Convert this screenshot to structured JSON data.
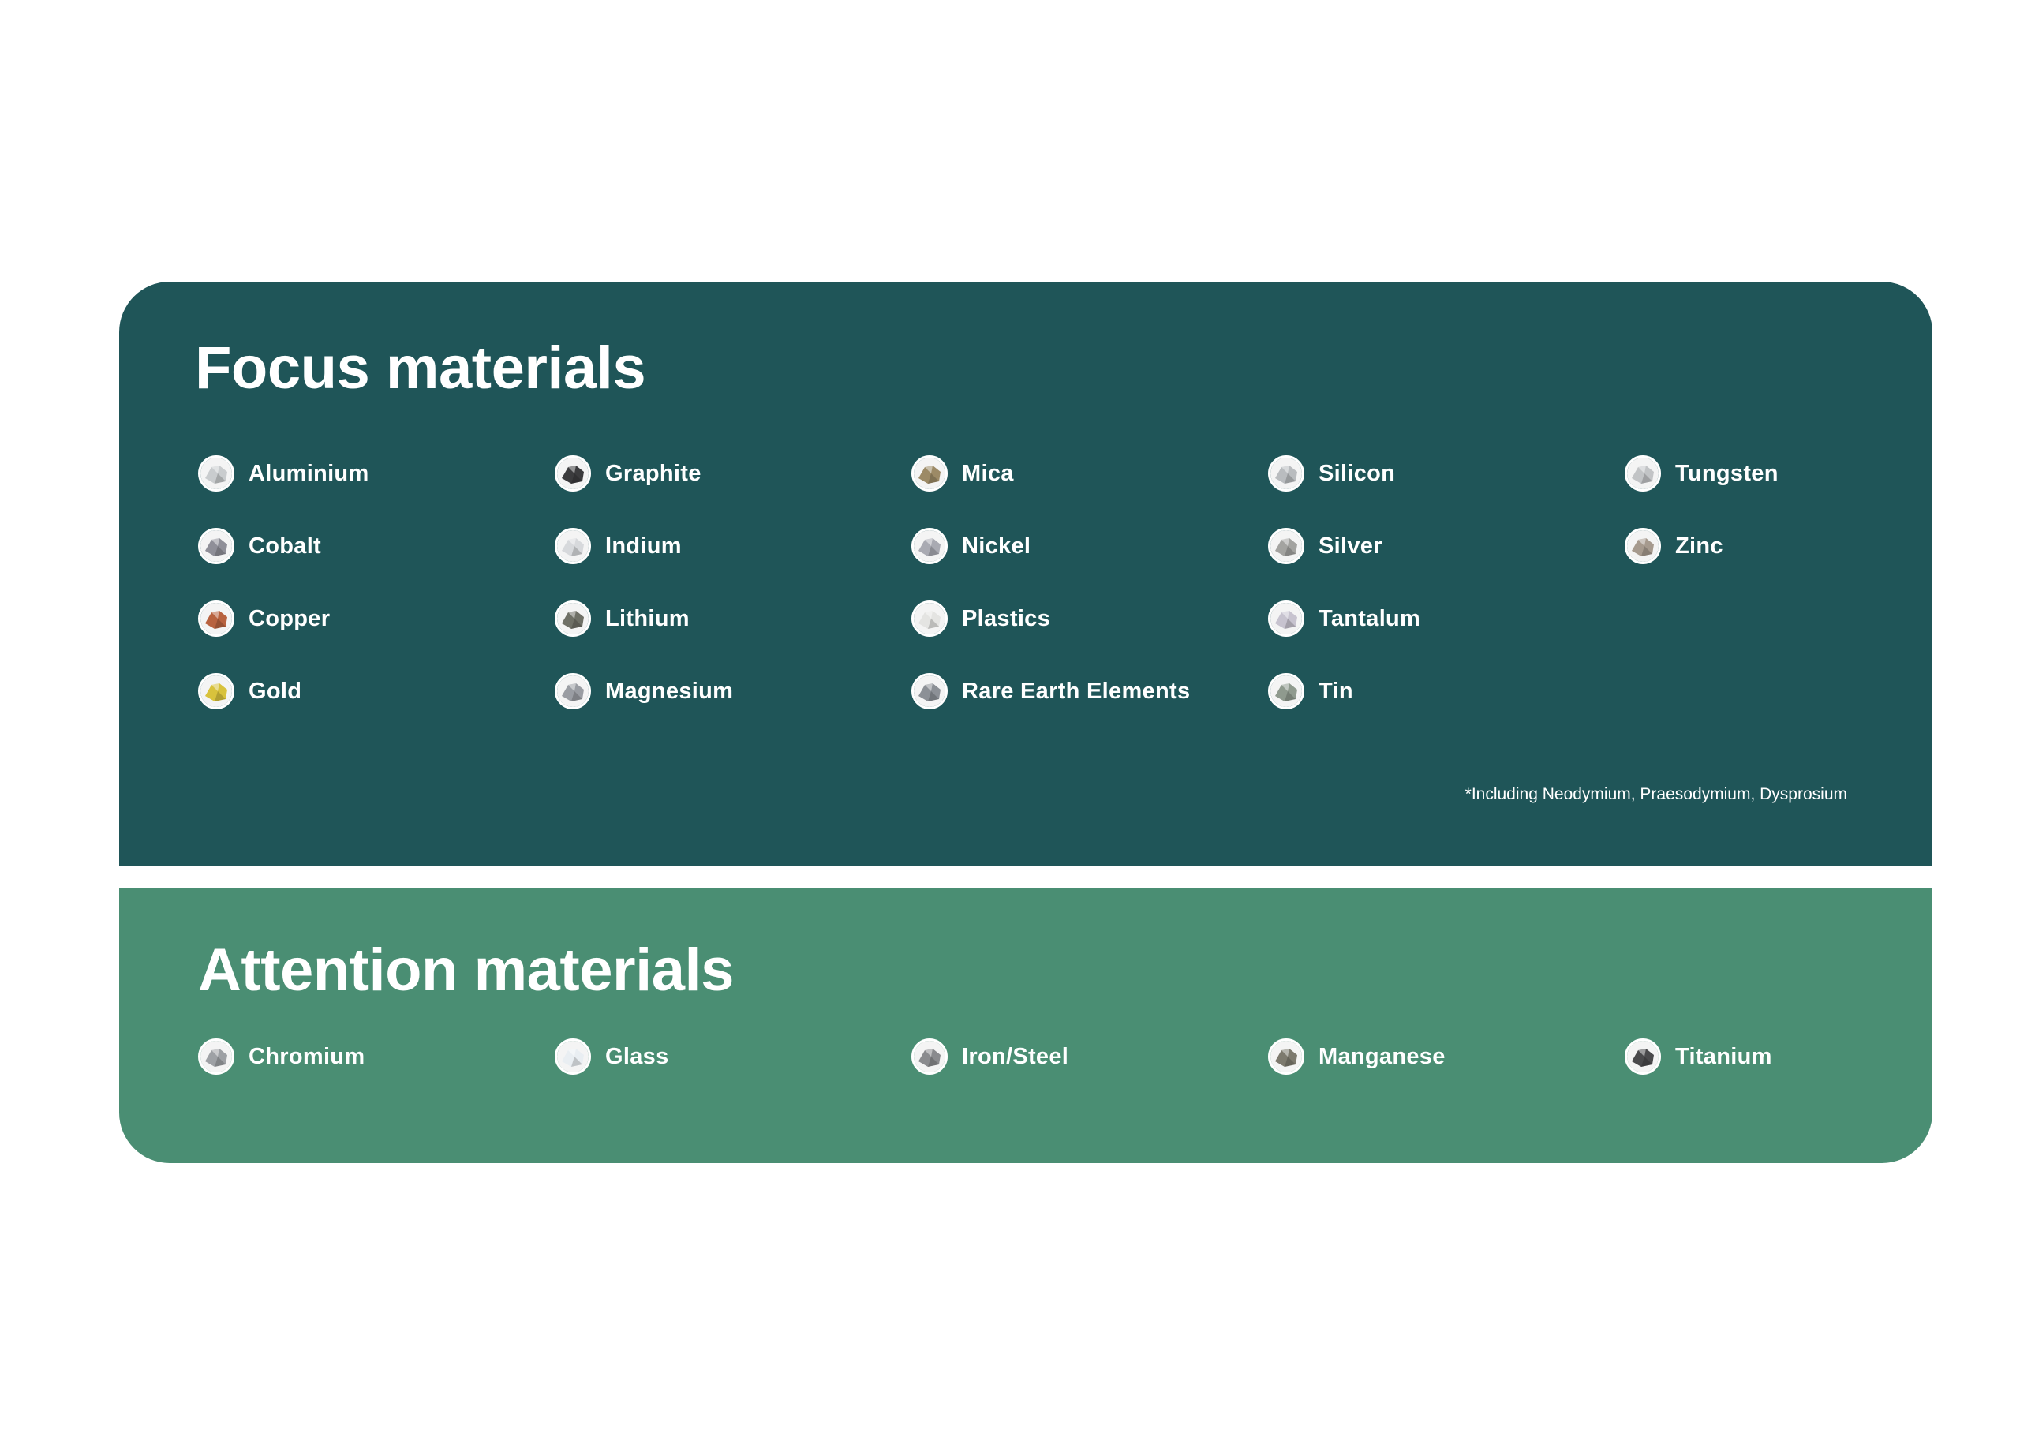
{
  "focus": {
    "title": "Focus materials",
    "color": "#1f5558",
    "items": [
      {
        "label": "Aluminium",
        "icon": "aluminium-icon",
        "tone": "#c9ccce"
      },
      {
        "label": "Cobalt",
        "icon": "cobalt-icon",
        "tone": "#8f8f98"
      },
      {
        "label": "Copper",
        "icon": "copper-icon",
        "tone": "#b8623f"
      },
      {
        "label": "Gold",
        "icon": "gold-icon",
        "tone": "#d8c23c"
      },
      {
        "label": "Graphite",
        "icon": "graphite-icon",
        "tone": "#3b3b3d"
      },
      {
        "label": "Indium",
        "icon": "indium-icon",
        "tone": "#d7d9dc"
      },
      {
        "label": "Lithium",
        "icon": "lithium-icon",
        "tone": "#6f7066"
      },
      {
        "label": "Magnesium",
        "icon": "magnesium-icon",
        "tone": "#9a9da3"
      },
      {
        "label": "Mica",
        "icon": "mica-icon",
        "tone": "#9c8a66"
      },
      {
        "label": "Nickel",
        "icon": "nickel-icon",
        "tone": "#a9aab2"
      },
      {
        "label": "Plastics",
        "icon": "plastics-icon",
        "tone": "#e4e4e2"
      },
      {
        "label": "Rare Earth Elements",
        "icon": "rare-earth-elements-icon",
        "tone": "#8c9096"
      },
      {
        "label": "Silicon",
        "icon": "silicon-icon",
        "tone": "#b9bcbf"
      },
      {
        "label": "Silver",
        "icon": "silver-icon",
        "tone": "#a3a3a0"
      },
      {
        "label": "Tantalum",
        "icon": "tantalum-icon",
        "tone": "#c7c3cf"
      },
      {
        "label": "Tin",
        "icon": "tin-icon",
        "tone": "#8f9a8e"
      },
      {
        "label": "Tungsten",
        "icon": "tungsten-icon",
        "tone": "#c2c4c6"
      },
      {
        "label": "Zinc",
        "icon": "zinc-icon",
        "tone": "#a69a8e"
      }
    ],
    "footnote": "*Including Neodymium, Praesodymium, Dysprosium"
  },
  "attention": {
    "title": "Attention materials",
    "color": "#4a8e73",
    "items": [
      {
        "label": "Chromium",
        "icon": "chromium-icon",
        "tone": "#9ea1a5"
      },
      {
        "label": "Glass",
        "icon": "glass-icon",
        "tone": "#e9eef2"
      },
      {
        "label": "Iron/Steel",
        "icon": "iron-steel-icon",
        "tone": "#8a8b8e"
      },
      {
        "label": "Manganese",
        "icon": "manganese-icon",
        "tone": "#7d7a6e"
      },
      {
        "label": "Titanium",
        "icon": "titanium-icon",
        "tone": "#4a4a4c"
      }
    ]
  }
}
